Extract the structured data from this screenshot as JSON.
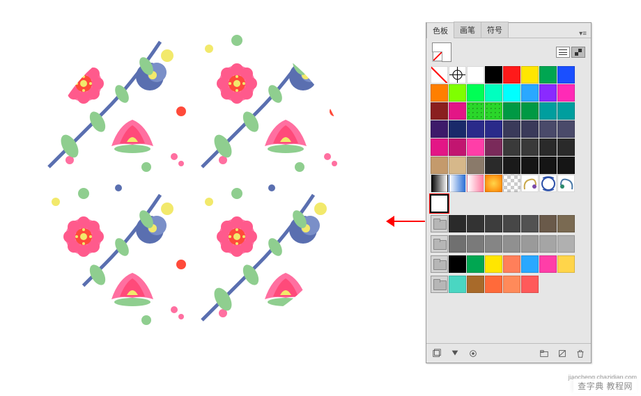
{
  "panel": {
    "tabs": {
      "swatches": "色板",
      "brushes": "画笔",
      "symbols": "符号"
    },
    "active_tab": "swatches",
    "grid": {
      "row1": [
        {
          "name": "none",
          "type": "none"
        },
        {
          "name": "registration",
          "type": "reg"
        },
        {
          "name": "white",
          "color": "#ffffff"
        },
        {
          "name": "black",
          "color": "#000000"
        },
        {
          "name": "red",
          "color": "#ff1a1a"
        },
        {
          "name": "yellow",
          "color": "#ffe600"
        },
        {
          "name": "green",
          "color": "#00a651"
        },
        {
          "name": "blue",
          "color": "#1a4fff"
        }
      ],
      "row2": [
        {
          "name": "orange",
          "color": "#ff7f00"
        },
        {
          "name": "lime",
          "color": "#7fff00"
        },
        {
          "name": "spring-green",
          "color": "#00ff55"
        },
        {
          "name": "aqua-green",
          "color": "#00ffbf"
        },
        {
          "name": "cyan",
          "color": "#00ffff"
        },
        {
          "name": "azure",
          "color": "#2aa8ff"
        },
        {
          "name": "violet",
          "color": "#8a2aff"
        },
        {
          "name": "rose",
          "color": "#ff2ab6"
        }
      ],
      "row3": [
        {
          "name": "dark-red",
          "color": "#8a1f1f"
        },
        {
          "name": "magenta",
          "color": "#e31686"
        },
        {
          "name": "bright-green",
          "color": "#2ad62a",
          "pattern": "dots"
        },
        {
          "name": "bright-green-2",
          "color": "#2ad62a",
          "pattern": "dots"
        },
        {
          "name": "emerald",
          "color": "#009944"
        },
        {
          "name": "emerald-2",
          "color": "#009944"
        },
        {
          "name": "teal",
          "color": "#009e9e"
        },
        {
          "name": "teal-2",
          "color": "#009e9e"
        }
      ],
      "row4": [
        {
          "name": "deep-purple",
          "color": "#3d1a6a"
        },
        {
          "name": "navy",
          "color": "#1a2a6a"
        },
        {
          "name": "indigo",
          "color": "#2a2a8a"
        },
        {
          "name": "indigo-2",
          "color": "#2a2a8a"
        },
        {
          "name": "slate",
          "color": "#3a3a5a"
        },
        {
          "name": "slate-2",
          "color": "#3a3a5a"
        },
        {
          "name": "steel",
          "color": "#4a4a6a"
        },
        {
          "name": "steel-2",
          "color": "#4a4a6a"
        }
      ],
      "row5": [
        {
          "name": "magenta-2",
          "color": "#e31686"
        },
        {
          "name": "magenta-3",
          "color": "#c21570"
        },
        {
          "name": "hot-pink",
          "color": "#ff3ea8"
        },
        {
          "name": "plum",
          "color": "#7a2a5a"
        },
        {
          "name": "dark-gray",
          "color": "#3a3a3a"
        },
        {
          "name": "dark-gray-2",
          "color": "#3a3a3a"
        },
        {
          "name": "darker-gray",
          "color": "#2a2a2a"
        },
        {
          "name": "darker-gray-2",
          "color": "#2a2a2a"
        }
      ],
      "row6": [
        {
          "name": "camel",
          "color": "#c49a6c"
        },
        {
          "name": "tan",
          "color": "#d6b88a"
        },
        {
          "name": "taupe",
          "color": "#8a7a6a"
        },
        {
          "name": "charcoal",
          "color": "#2a2a2a"
        },
        {
          "name": "darkest",
          "color": "#1a1a1a"
        },
        {
          "name": "near-black",
          "color": "#151515"
        },
        {
          "name": "near-black-2",
          "color": "#151515"
        },
        {
          "name": "near-black-3",
          "color": "#151515"
        }
      ],
      "row7": [
        {
          "name": "grad-bw",
          "type": "gradbk"
        },
        {
          "name": "grad-blue",
          "type": "gradbl"
        },
        {
          "name": "grad-pink",
          "type": "gradpk"
        },
        {
          "name": "grad-sun",
          "type": "gradsun"
        },
        {
          "name": "transparent",
          "type": "trans"
        },
        {
          "name": "pattern-ornament-left",
          "type": "pattern",
          "variant": "ornL"
        },
        {
          "name": "pattern-blue-white",
          "type": "pattern",
          "variant": "bw"
        },
        {
          "name": "pattern-ornament-right",
          "type": "pattern",
          "variant": "ornR"
        }
      ],
      "row8": [
        {
          "name": "new-floral-pattern",
          "type": "pattern",
          "variant": "floral",
          "selected": true,
          "highlight": true
        }
      ]
    },
    "folder1": {
      "name": "gray-group",
      "swatches": [
        {
          "name": "g1",
          "color": "#2a2a2a"
        },
        {
          "name": "g2",
          "color": "#333333"
        },
        {
          "name": "g3",
          "color": "#3d3d3d"
        },
        {
          "name": "g4",
          "color": "#474747"
        },
        {
          "name": "g5",
          "color": "#525252"
        },
        {
          "name": "g6",
          "color": "#6a5a4a"
        },
        {
          "name": "g7",
          "color": "#7a6a52"
        }
      ]
    },
    "folder2": {
      "name": "neutral-group",
      "swatches": [
        {
          "name": "n1",
          "color": "#707070"
        },
        {
          "name": "n2",
          "color": "#7a7a7a"
        },
        {
          "name": "n3",
          "color": "#858585"
        },
        {
          "name": "n4",
          "color": "#909090"
        },
        {
          "name": "n5",
          "color": "#9a9a9a"
        },
        {
          "name": "n6",
          "color": "#a5a5a5"
        },
        {
          "name": "n7",
          "color": "#b0b0b0"
        }
      ]
    },
    "folder3": {
      "name": "color-group",
      "swatches": [
        {
          "name": "c1",
          "color": "#000000"
        },
        {
          "name": "c2",
          "color": "#00a651"
        },
        {
          "name": "c3",
          "color": "#ffe600"
        },
        {
          "name": "c4",
          "color": "#ff7f5a"
        },
        {
          "name": "c5",
          "color": "#2aa8ff"
        },
        {
          "name": "c6",
          "color": "#ff3ea8"
        },
        {
          "name": "c7",
          "color": "#ffd54a"
        }
      ]
    },
    "folder4": {
      "name": "warm-group",
      "swatches": [
        {
          "name": "w1",
          "color": "#4ad6c2"
        },
        {
          "name": "w2",
          "color": "#a86a2a"
        },
        {
          "name": "w3",
          "color": "#ff6a3a"
        },
        {
          "name": "w4",
          "color": "#ff8a5a"
        },
        {
          "name": "w5",
          "color": "#ff5a5a"
        }
      ]
    }
  },
  "watermark": {
    "text": "查字典 教程网",
    "domain": "jiaocheng.chazidian.com"
  }
}
